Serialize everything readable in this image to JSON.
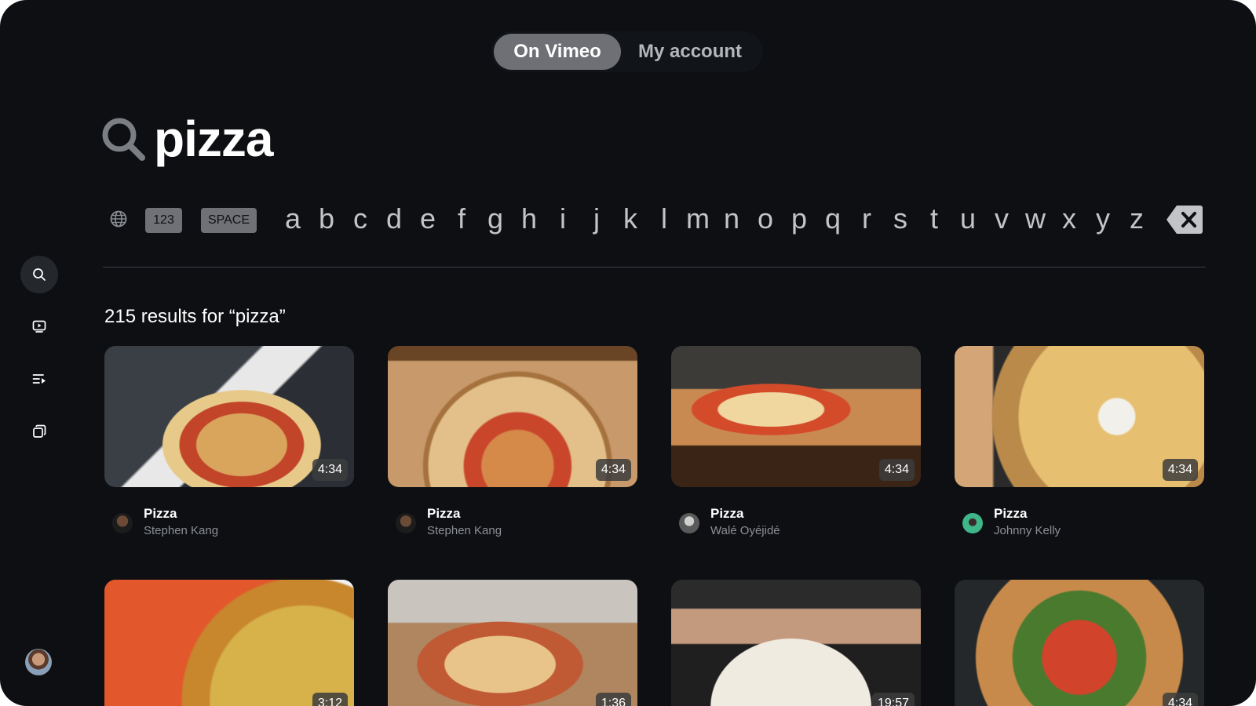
{
  "tabs": [
    {
      "label": "On Vimeo",
      "active": true
    },
    {
      "label": "My account",
      "active": false
    }
  ],
  "search": {
    "query": "pizza",
    "icon": "search-icon"
  },
  "keyboard": {
    "globe_icon": "globe-icon",
    "key_123": "123",
    "key_space": "SPACE",
    "letters": [
      "a",
      "b",
      "c",
      "d",
      "e",
      "f",
      "g",
      "h",
      "i",
      "j",
      "k",
      "l",
      "m",
      "n",
      "o",
      "p",
      "q",
      "r",
      "s",
      "t",
      "u",
      "v",
      "w",
      "x",
      "y",
      "z"
    ],
    "backspace_icon": "backspace-icon"
  },
  "sidebar": {
    "items": [
      {
        "icon": "search-icon",
        "active": true
      },
      {
        "icon": "video-icon",
        "active": false
      },
      {
        "icon": "playlist-icon",
        "active": false
      },
      {
        "icon": "library-icon",
        "active": false
      }
    ],
    "avatar": "avatar"
  },
  "results": {
    "heading": "215 results for “pizza”",
    "videos": [
      {
        "title": "Pizza",
        "author": "Stephen Kang",
        "duration": "4:34"
      },
      {
        "title": "Pizza",
        "author": "Stephen Kang",
        "duration": "4:34"
      },
      {
        "title": "Pizza",
        "author": "Walé Oyéjidé",
        "duration": "4:34"
      },
      {
        "title": "Pizza",
        "author": "Johnny Kelly",
        "duration": "4:34"
      },
      {
        "duration": "3:12"
      },
      {
        "duration": "1:36"
      },
      {
        "duration": "19:57"
      },
      {
        "duration": "4:34"
      }
    ]
  }
}
